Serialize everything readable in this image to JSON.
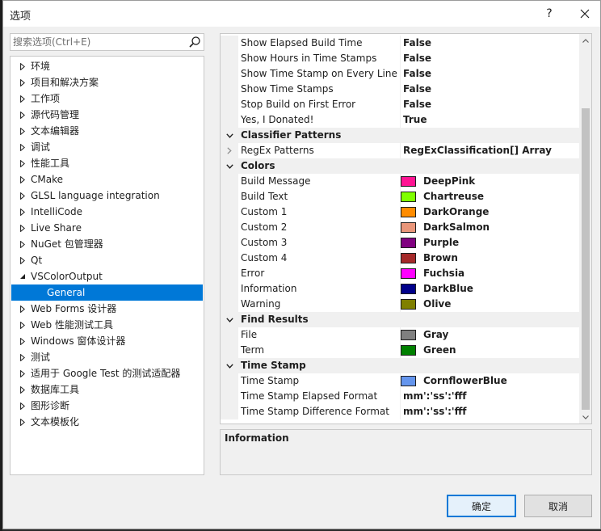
{
  "window": {
    "title": "选项",
    "help_label": "?",
    "close_label": "✕"
  },
  "search": {
    "placeholder": "搜索选项(Ctrl+E)"
  },
  "tree": {
    "items": [
      {
        "label": "环境"
      },
      {
        "label": "项目和解决方案"
      },
      {
        "label": "工作项"
      },
      {
        "label": "源代码管理"
      },
      {
        "label": "文本编辑器"
      },
      {
        "label": "调试"
      },
      {
        "label": "性能工具"
      },
      {
        "label": "CMake"
      },
      {
        "label": "GLSL language integration"
      },
      {
        "label": "IntelliCode"
      },
      {
        "label": "Live Share"
      },
      {
        "label": "NuGet 包管理器"
      },
      {
        "label": "Qt"
      },
      {
        "label": "VSColorOutput",
        "expanded": true
      },
      {
        "label": "General",
        "child": true,
        "selected": true
      },
      {
        "label": "Web Forms 设计器"
      },
      {
        "label": "Web 性能测试工具"
      },
      {
        "label": "Windows 窗体设计器"
      },
      {
        "label": "测试"
      },
      {
        "label": "适用于 Google Test 的测试适配器"
      },
      {
        "label": "数据库工具"
      },
      {
        "label": "图形诊断"
      },
      {
        "label": "文本模板化"
      }
    ]
  },
  "grid": {
    "rows": [
      {
        "kind": "prop",
        "name": "Show Elapsed Build Time",
        "value": "False"
      },
      {
        "kind": "prop",
        "name": "Show Hours in Time Stamps",
        "value": "False"
      },
      {
        "kind": "prop",
        "name": "Show Time Stamp on Every Line",
        "value": "False"
      },
      {
        "kind": "prop",
        "name": "Show Time Stamps",
        "value": "False"
      },
      {
        "kind": "prop",
        "name": "Stop Build on First Error",
        "value": "False"
      },
      {
        "kind": "prop",
        "name": "Yes, I Donated!",
        "value": "True"
      },
      {
        "kind": "cat",
        "name": "Classifier Patterns"
      },
      {
        "kind": "prop",
        "name": "RegEx Patterns",
        "value": "RegExClassification[] Array",
        "expandable": true
      },
      {
        "kind": "cat",
        "name": "Colors"
      },
      {
        "kind": "color",
        "name": "Build Message",
        "value": "DeepPink",
        "color": "#FF1493"
      },
      {
        "kind": "color",
        "name": "Build Text",
        "value": "Chartreuse",
        "color": "#7FFF00"
      },
      {
        "kind": "color",
        "name": "Custom 1",
        "value": "DarkOrange",
        "color": "#FF8C00"
      },
      {
        "kind": "color",
        "name": "Custom 2",
        "value": "DarkSalmon",
        "color": "#E9967A"
      },
      {
        "kind": "color",
        "name": "Custom 3",
        "value": "Purple",
        "color": "#800080"
      },
      {
        "kind": "color",
        "name": "Custom 4",
        "value": "Brown",
        "color": "#A52A2A"
      },
      {
        "kind": "color",
        "name": "Error",
        "value": "Fuchsia",
        "color": "#FF00FF"
      },
      {
        "kind": "color",
        "name": "Information",
        "value": "DarkBlue",
        "color": "#00008B"
      },
      {
        "kind": "color",
        "name": "Warning",
        "value": "Olive",
        "color": "#808000"
      },
      {
        "kind": "cat",
        "name": "Find Results"
      },
      {
        "kind": "color",
        "name": "File",
        "value": "Gray",
        "color": "#808080"
      },
      {
        "kind": "color",
        "name": "Term",
        "value": "Green",
        "color": "#008000"
      },
      {
        "kind": "cat",
        "name": "Time Stamp"
      },
      {
        "kind": "color",
        "name": "Time Stamp",
        "value": "CornflowerBlue",
        "color": "#6495ED"
      },
      {
        "kind": "prop",
        "name": "Time Stamp  Elapsed Format",
        "value": "mm':'ss':'fff"
      },
      {
        "kind": "prop",
        "name": "Time Stamp Difference Format",
        "value": "mm':'ss':'fff"
      }
    ]
  },
  "description": {
    "title": "Information"
  },
  "buttons": {
    "ok_label": "确定",
    "cancel_label": "取消"
  }
}
